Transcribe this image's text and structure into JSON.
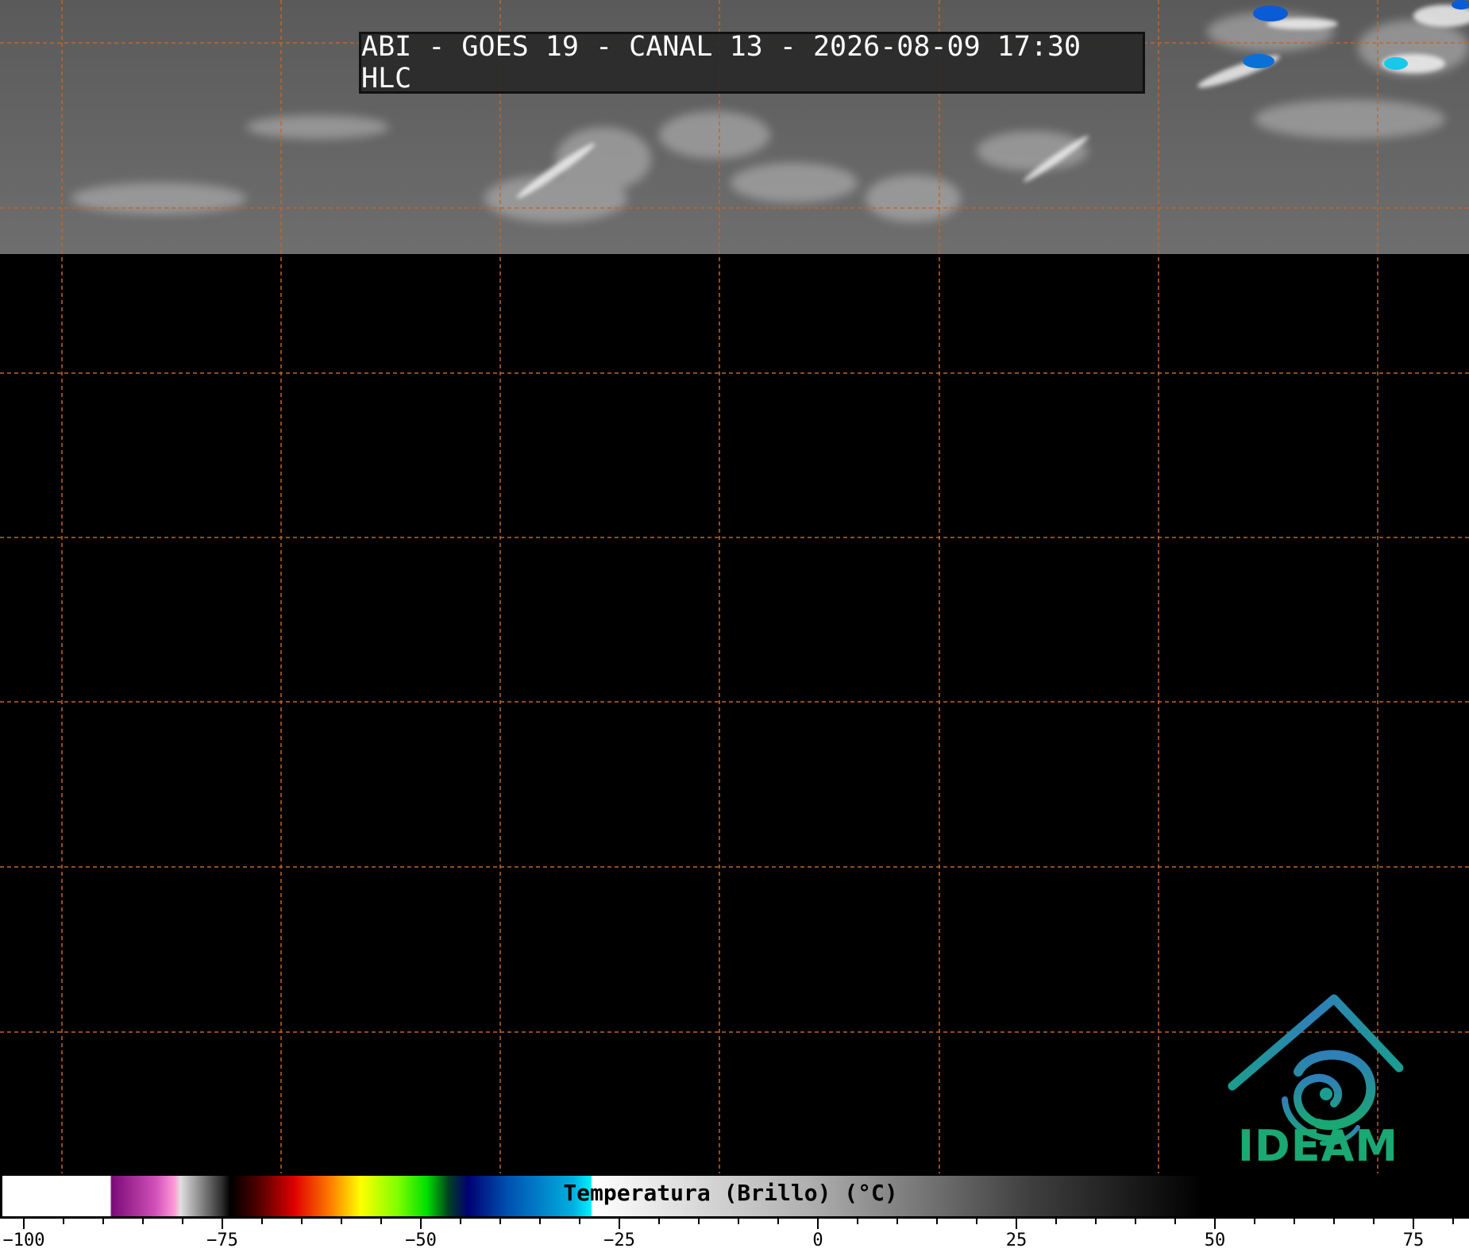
{
  "title": "ABI - GOES 19 - CANAL 13 - 2026-08-09 17:30 HLC",
  "logo": {
    "text": "IDEAM",
    "icon": "ideam-logo-icon"
  },
  "colorbar": {
    "label": "Temperatura (Brillo) (°C)",
    "min": -103,
    "max": 82,
    "ticks": [
      "−100",
      "−75",
      "−50",
      "−25",
      "0",
      "25",
      "50",
      "75"
    ],
    "tick_values": [
      -100,
      -75,
      -50,
      -25,
      0,
      25,
      50,
      75
    ],
    "minor_step": 5
  },
  "colors": {
    "gridline": "#c0662a",
    "background": "#000000",
    "logo_teal": "#1aa873",
    "logo_blue": "#2f7fb8"
  },
  "grid": {
    "style": "dashed"
  }
}
